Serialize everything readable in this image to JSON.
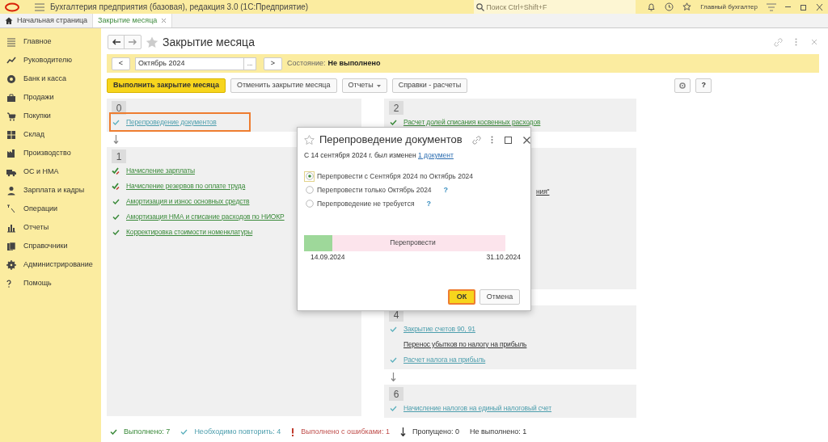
{
  "app_bar": {
    "title": "Бухгалтерия предприятия (базовая), редакция 3.0  (1С:Предприятие)",
    "search": {
      "placeholder": "Поиск Ctrl+Shift+F"
    },
    "user": "Главный бухгалтер"
  },
  "tabs": [
    {
      "label": "Начальная страница",
      "selected": false,
      "kind": "home"
    },
    {
      "label": "Закрытие месяца",
      "selected": true,
      "kind": "doc"
    }
  ],
  "sidebar": {
    "items": [
      {
        "label": "Главное"
      },
      {
        "label": "Руководителю"
      },
      {
        "label": "Банк и касса"
      },
      {
        "label": "Продажи"
      },
      {
        "label": "Покупки"
      },
      {
        "label": "Склад"
      },
      {
        "label": "Производство"
      },
      {
        "label": "ОС и НМА"
      },
      {
        "label": "Зарплата и кадры"
      },
      {
        "label": "Операции"
      },
      {
        "label": "Отчеты"
      },
      {
        "label": "Справочники"
      },
      {
        "label": "Администрирование"
      },
      {
        "label": "Помощь"
      }
    ]
  },
  "form": {
    "title": "Закрытие месяца",
    "period": {
      "prev": "<",
      "value": "Октябрь 2024",
      "choose": "...",
      "next": ">"
    },
    "state_label": "Состояние:",
    "state_value": "Не выполнено",
    "buttons": [
      {
        "label": "Выполнить закрытие месяца",
        "kind": "primary"
      },
      {
        "label": "Отменить закрытие месяца",
        "kind": "plain"
      },
      {
        "label": "Отчеты",
        "kind": "menu"
      },
      {
        "label": "Справки - расчеты",
        "kind": "plain"
      }
    ],
    "help": "?",
    "columns": [
      [
        {
          "number": "0",
          "arrow_after": true,
          "items": [
            {
              "label": "Перепроведение документов",
              "kind": "repeat",
              "highlighted": true
            }
          ]
        },
        {
          "number": "1",
          "items": [
            {
              "label": "Начисление зарплаты",
              "kind": "warn"
            },
            {
              "label": "Начисление резервов по оплате труда",
              "kind": "warn"
            },
            {
              "label": "Амортизация и износ основных средств",
              "kind": "done"
            },
            {
              "label": "Амортизация НМА и списание расходов по НИОКР",
              "kind": "done"
            },
            {
              "label": "Корректировка стоимости номенклатуры",
              "kind": "done"
            }
          ]
        }
      ],
      [
        {
          "number": "2",
          "items": [
            {
              "label": "Расчет долей списания косвенных расходов",
              "kind": "done"
            }
          ]
        },
        {
          "items": [
            {
              "label": "ния\"",
              "kind": "partial"
            }
          ]
        },
        {
          "number": "4",
          "arrow_after": true,
          "items": [
            {
              "label": "Закрытие счетов 90, 91",
              "kind": "repeat"
            },
            {
              "label": "Перенос убытков по налогу на прибыль",
              "kind": "none"
            },
            {
              "label": "Расчет налога на прибыль",
              "kind": "repeat"
            }
          ]
        },
        {
          "number": "6",
          "items": [
            {
              "label": "Начисление налогов на единый налоговый счет",
              "kind": "repeat"
            }
          ]
        }
      ]
    ],
    "legend": [
      {
        "label": "Выполнено: 7",
        "kind": "done"
      },
      {
        "label": "Необходимо повторить: 4",
        "kind": "repeat"
      },
      {
        "label": "Выполнено с ошибками: 1",
        "kind": "error"
      },
      {
        "label": "Пропущено: 0",
        "kind": "skipped"
      },
      {
        "label": "Не выполнено: 1",
        "kind": "none"
      }
    ]
  },
  "dialog": {
    "title": "Перепроведение документов",
    "info": "С 14 сентября 2024 г. был изменен",
    "info_link": "1 документ",
    "options": [
      {
        "label": "Перепровести с Сентября 2024 по Октябрь 2024",
        "selected": true,
        "help": false
      },
      {
        "label": "Перепровести только Октябрь 2024",
        "selected": false,
        "help": true
      },
      {
        "label": "Перепроведение не требуется",
        "selected": false,
        "help": true
      }
    ],
    "help_mark": "?",
    "timeline": {
      "label": "Перепровести",
      "level": 0.14,
      "start": "14.09.2024",
      "end": "31.10.2024"
    },
    "buttons": [
      {
        "label": "ОК",
        "kind": "primary",
        "highlighted": true
      },
      {
        "label": "Отмена",
        "kind": "plain",
        "highlighted": false
      }
    ]
  }
}
